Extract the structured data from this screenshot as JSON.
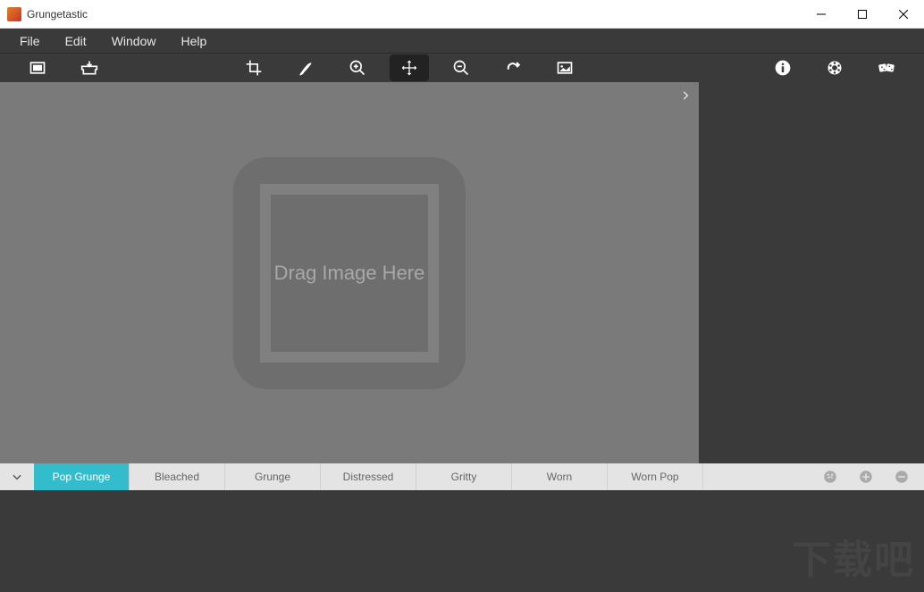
{
  "titlebar": {
    "title": "Grungetastic"
  },
  "menubar": {
    "items": [
      "File",
      "Edit",
      "Window",
      "Help"
    ]
  },
  "toolbar": {
    "left": [
      {
        "name": "open-image-icon"
      },
      {
        "name": "save-image-icon"
      }
    ],
    "center": [
      {
        "name": "crop-icon"
      },
      {
        "name": "brush-icon"
      },
      {
        "name": "zoom-in-icon"
      },
      {
        "name": "move-icon",
        "active": true
      },
      {
        "name": "zoom-out-icon"
      },
      {
        "name": "redo-icon"
      },
      {
        "name": "fit-screen-icon"
      }
    ],
    "right": [
      {
        "name": "info-icon"
      },
      {
        "name": "settings-icon"
      },
      {
        "name": "randomize-icon"
      }
    ]
  },
  "canvas": {
    "dropzone_text": "Drag Image Here"
  },
  "presets": {
    "tabs": [
      {
        "label": "Pop Grunge",
        "active": true
      },
      {
        "label": "Bleached",
        "active": false
      },
      {
        "label": "Grunge",
        "active": false
      },
      {
        "label": "Distressed",
        "active": false
      },
      {
        "label": "Gritty",
        "active": false
      },
      {
        "label": "Worn",
        "active": false
      },
      {
        "label": "Worn Pop",
        "active": false
      }
    ],
    "actions": [
      "preset-manage-icon",
      "add-preset-icon",
      "remove-preset-icon"
    ]
  },
  "watermark": "下载吧"
}
